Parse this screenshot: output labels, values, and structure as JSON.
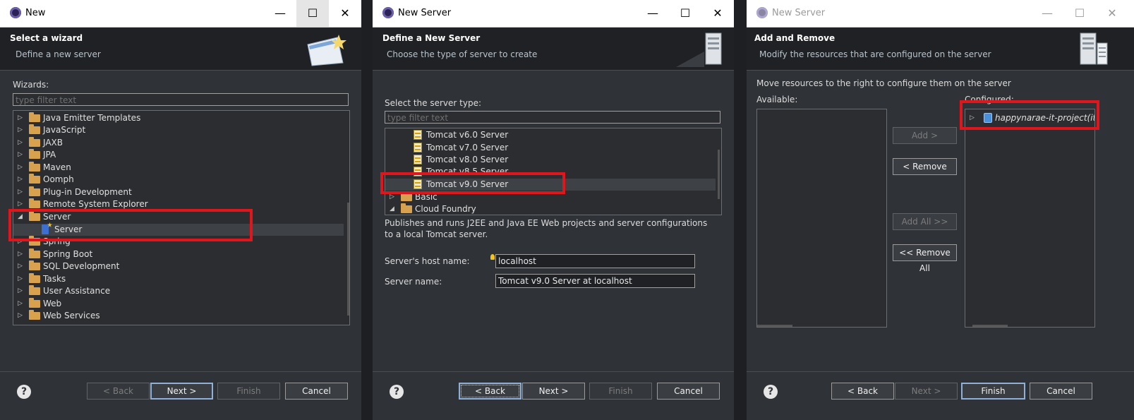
{
  "dialog1": {
    "title": "New",
    "header_title": "Select a wizard",
    "header_desc": "Define a new server",
    "wizards_label": "Wizards:",
    "filter_placeholder": "type filter text",
    "tree": [
      {
        "label": "Java Emitter Templates",
        "icon": "folder-icon",
        "expanded": false
      },
      {
        "label": "JavaScript",
        "icon": "folder-icon",
        "expanded": false
      },
      {
        "label": "JAXB",
        "icon": "folder-icon",
        "expanded": false
      },
      {
        "label": "JPA",
        "icon": "folder-icon",
        "expanded": false
      },
      {
        "label": "Maven",
        "icon": "folder-icon",
        "expanded": false
      },
      {
        "label": "Oomph",
        "icon": "folder-icon",
        "expanded": false
      },
      {
        "label": "Plug-in Development",
        "icon": "folder-icon",
        "expanded": false
      },
      {
        "label": "Remote System Explorer",
        "icon": "folder-icon",
        "expanded": false
      },
      {
        "label": "Server",
        "icon": "folder-icon",
        "expanded": true
      },
      {
        "label": "Server",
        "icon": "server-wizard-icon",
        "child": true,
        "selected": true
      },
      {
        "label": "Spring",
        "icon": "folder-icon",
        "expanded": false
      },
      {
        "label": "Spring Boot",
        "icon": "folder-icon",
        "expanded": false
      },
      {
        "label": "SQL Development",
        "icon": "folder-icon",
        "expanded": false
      },
      {
        "label": "Tasks",
        "icon": "folder-icon",
        "expanded": false
      },
      {
        "label": "User Assistance",
        "icon": "folder-icon",
        "expanded": false
      },
      {
        "label": "Web",
        "icon": "folder-icon",
        "expanded": false
      },
      {
        "label": "Web Services",
        "icon": "folder-icon",
        "expanded": false
      }
    ],
    "buttons": {
      "back": "< Back",
      "next": "Next >",
      "finish": "Finish",
      "cancel": "Cancel"
    }
  },
  "dialog2": {
    "title": "New Server",
    "header_title": "Define a New Server",
    "header_desc": "Choose the type of server to create",
    "server_type_label": "Select the server type:",
    "filter_placeholder": "type filter text",
    "tree": [
      {
        "label": "Tomcat v6.0 Server",
        "icon": "tomcat-server-icon"
      },
      {
        "label": "Tomcat v7.0 Server",
        "icon": "tomcat-server-icon"
      },
      {
        "label": "Tomcat v8.0 Server",
        "icon": "tomcat-server-icon"
      },
      {
        "label": "Tomcat v8.5 Server",
        "icon": "tomcat-server-icon"
      },
      {
        "label": "Tomcat v9.0 Server",
        "icon": "tomcat-server-icon",
        "selected": true
      },
      {
        "label": "Basic",
        "icon": "folder-icon",
        "expanded": false
      },
      {
        "label": "Cloud Foundry",
        "icon": "folder-icon",
        "expanded": true
      }
    ],
    "description": "Publishes and runs J2EE and Java EE Web projects and server configurations to a local Tomcat server.",
    "host_label": "Server's host name:",
    "host_value": "localhost",
    "name_label": "Server name:",
    "name_value": "Tomcat v9.0 Server at localhost",
    "buttons": {
      "back": "< Back",
      "next": "Next >",
      "finish": "Finish",
      "cancel": "Cancel"
    }
  },
  "dialog3": {
    "title": "New Server",
    "header_title": "Add and Remove",
    "header_desc": "Modify the resources that are configured on the server",
    "instruction": "Move resources to the right to configure them on the server",
    "available_label": "Available:",
    "configured_label": "Configured:",
    "configured_items": [
      {
        "label": "happynarae-it-project(itap",
        "icon": "web-project-icon"
      }
    ],
    "move_buttons": {
      "add": "Add >",
      "remove": "< Remove",
      "add_all": "Add All >>",
      "remove_all": "<< Remove All"
    },
    "buttons": {
      "back": "< Back",
      "next": "Next >",
      "finish": "Finish",
      "cancel": "Cancel"
    }
  },
  "colors": {
    "highlight_box": "#e0161c",
    "dialog_bg": "#2f3236",
    "header_bg": "#1f2124"
  }
}
